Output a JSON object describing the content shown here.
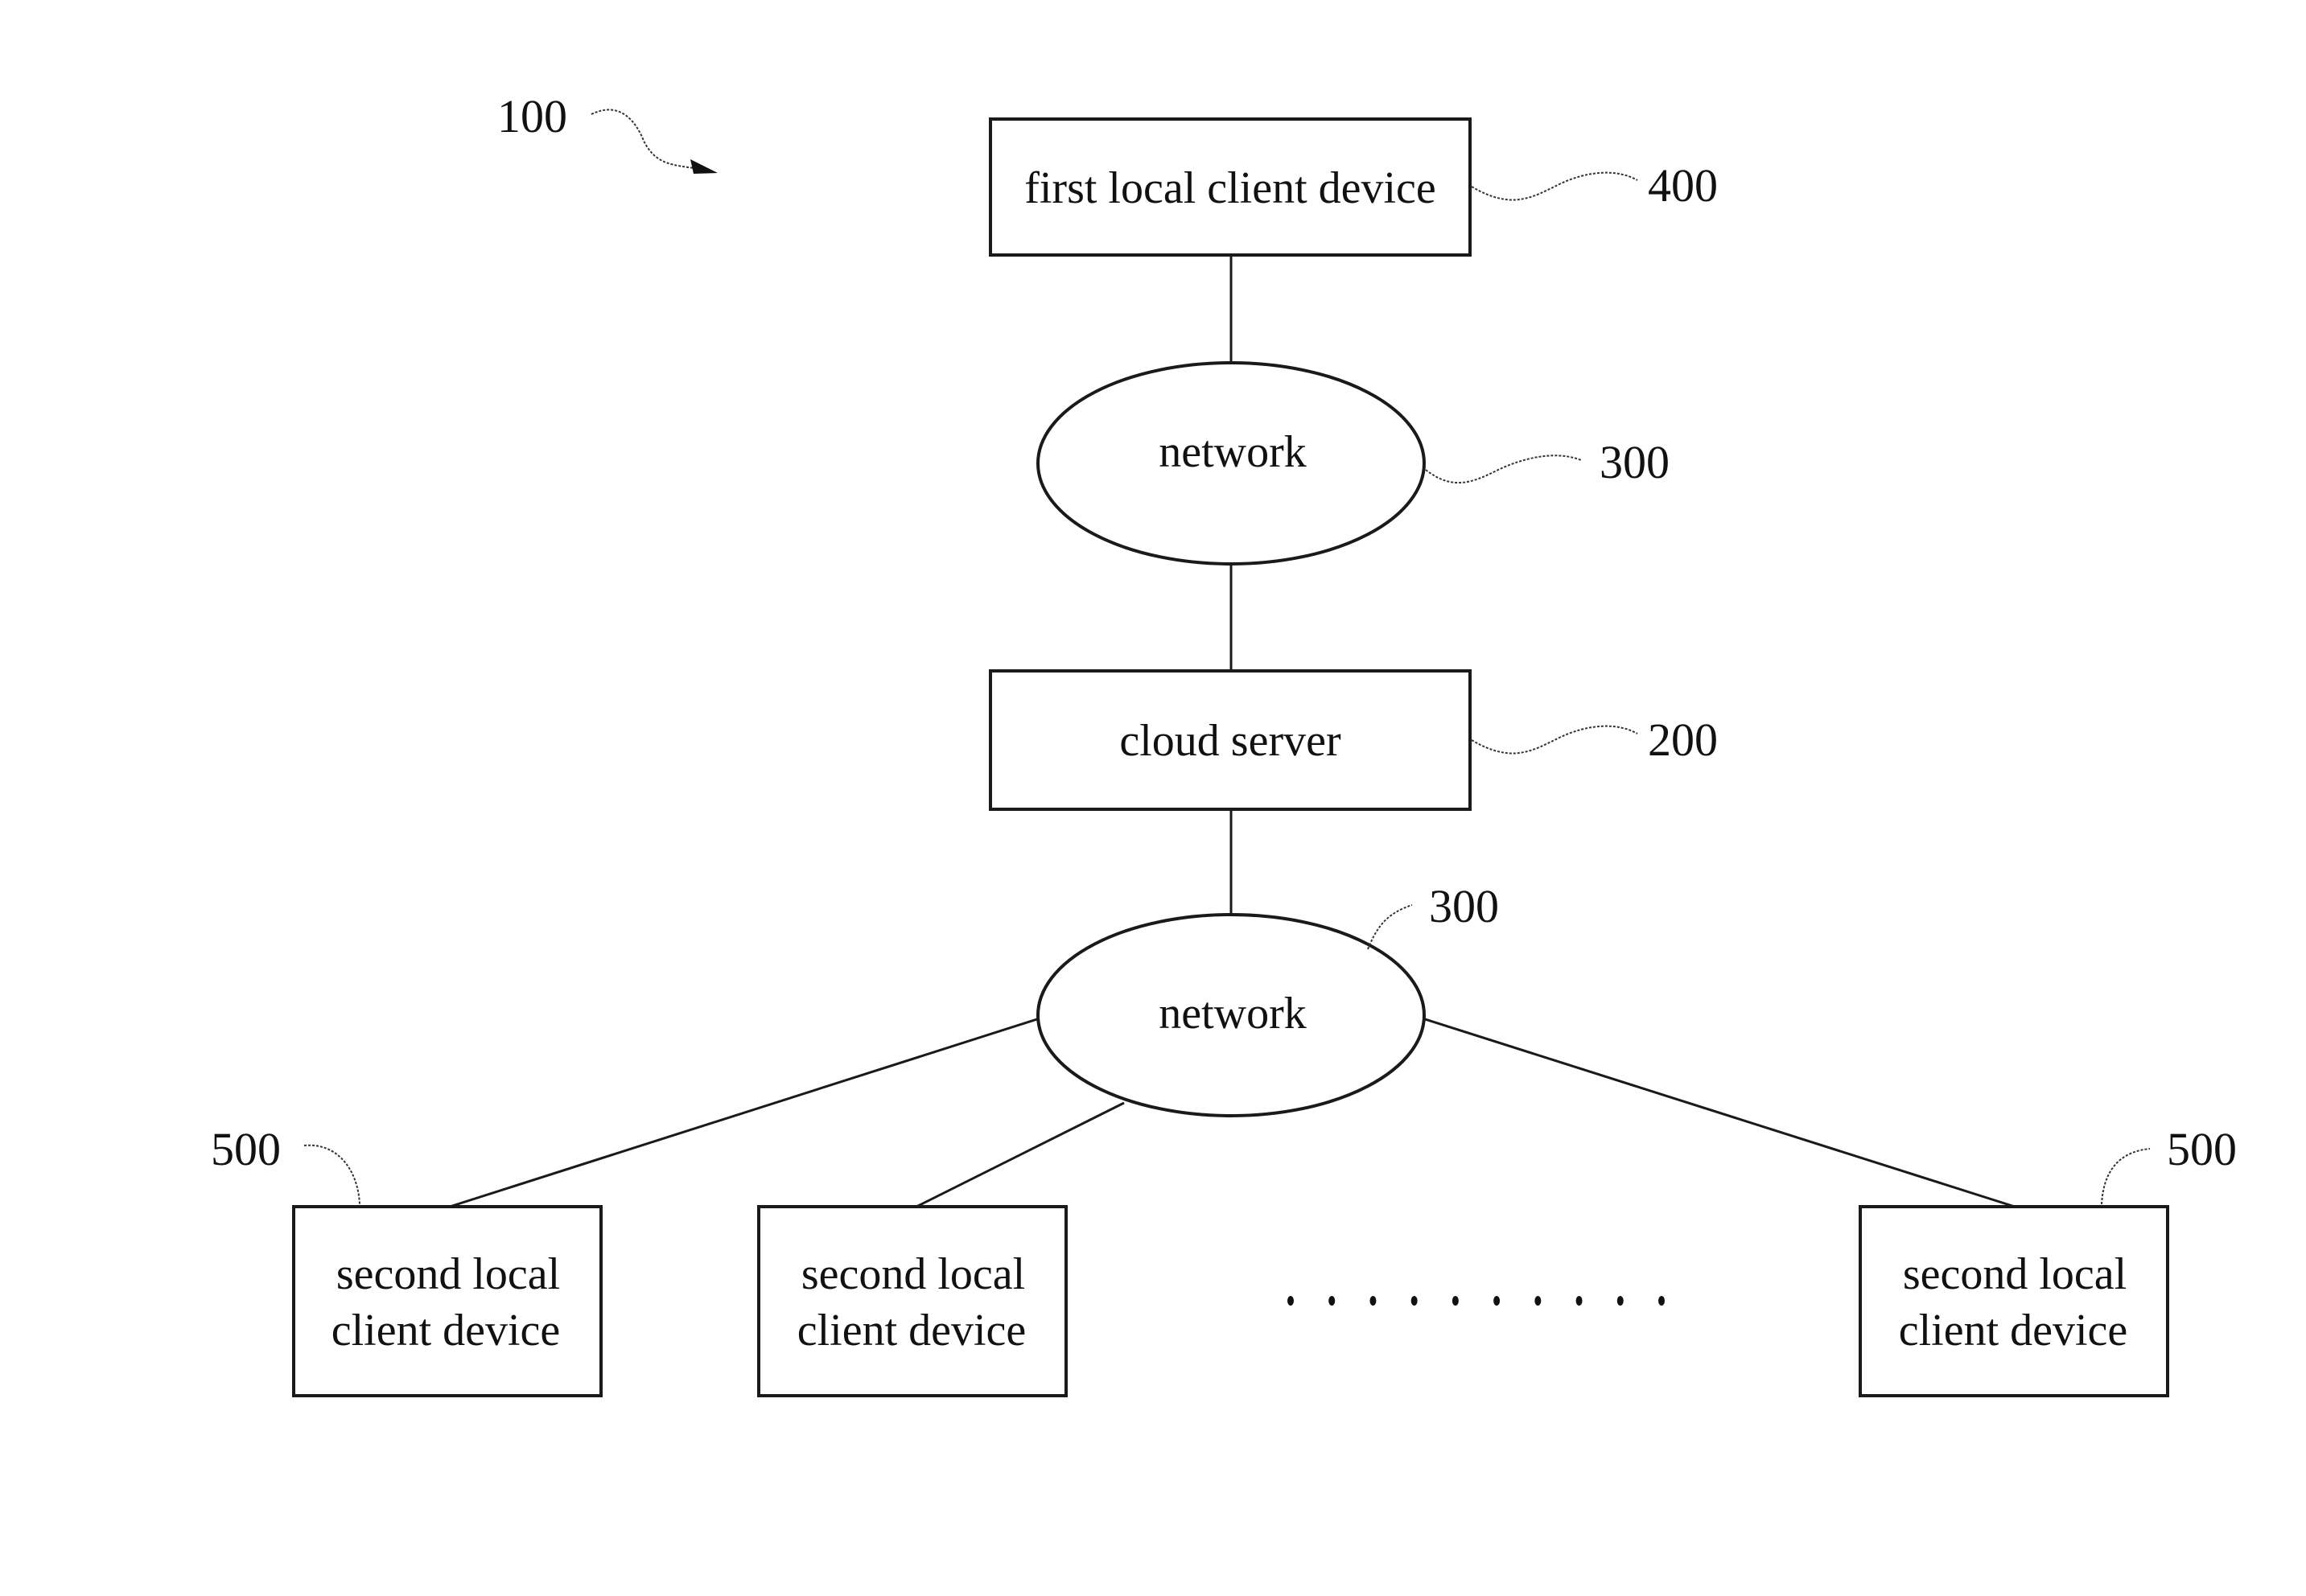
{
  "figure": {
    "system_ref": "100",
    "nodes": {
      "first_client": {
        "label": "first local client device",
        "ref": "400"
      },
      "network_top": {
        "label": "network",
        "ref": "300"
      },
      "cloud_server": {
        "label": "cloud server",
        "ref": "200"
      },
      "network_bottom": {
        "label": "network",
        "ref": "300"
      },
      "second_clients": [
        {
          "line1": "second local",
          "line2": "client device",
          "ref": "500"
        },
        {
          "line1": "second local",
          "line2": "client device"
        },
        {
          "line1": "second local",
          "line2": "client device",
          "ref": "500"
        }
      ]
    },
    "ellipsis_dot_count": 10
  }
}
